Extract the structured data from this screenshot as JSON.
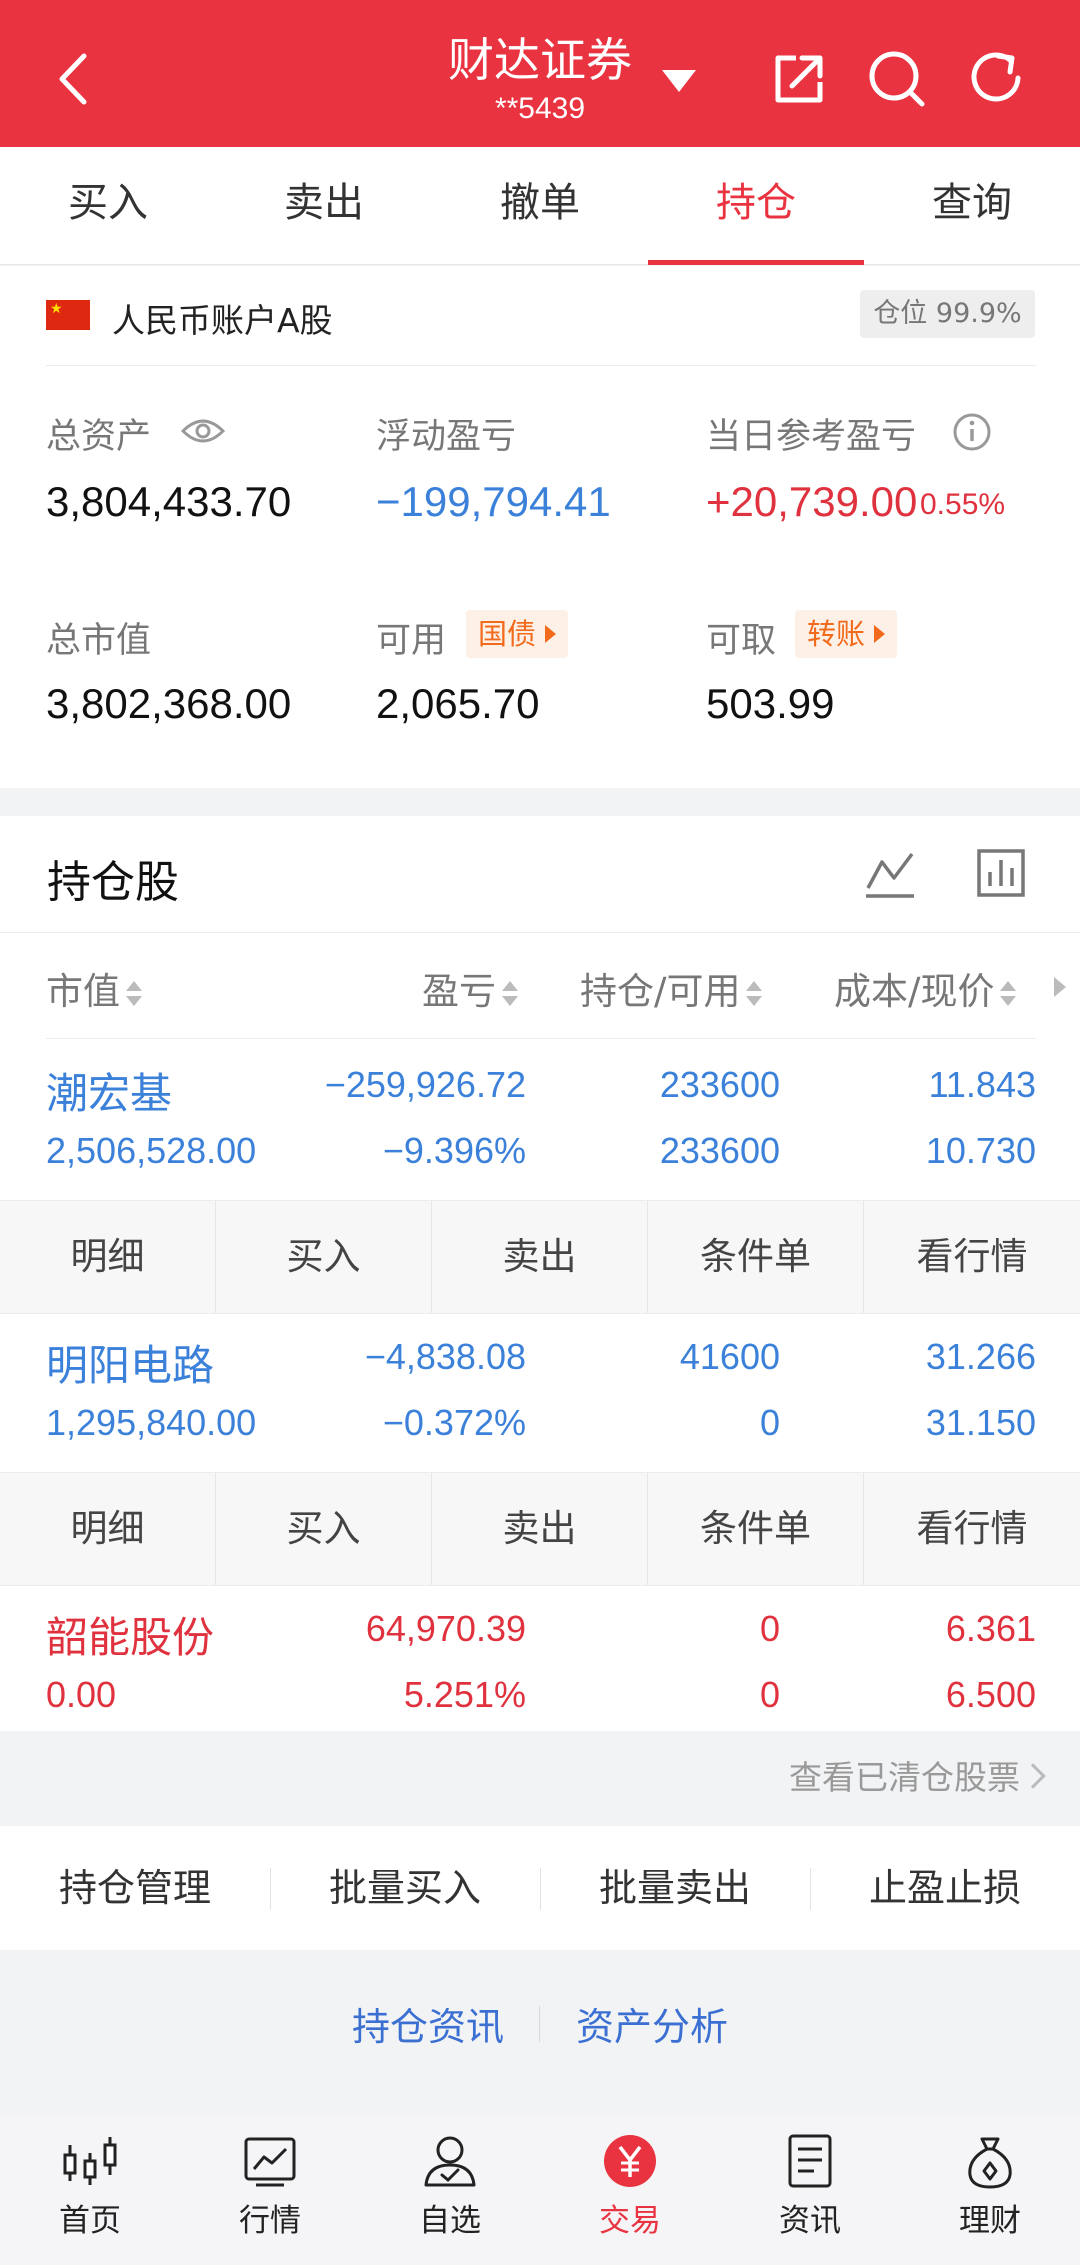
{
  "header": {
    "title": "财达证券",
    "account_masked": "**5439"
  },
  "tabs": [
    {
      "label": "买入"
    },
    {
      "label": "卖出"
    },
    {
      "label": "撤单"
    },
    {
      "label": "持仓",
      "active": true
    },
    {
      "label": "查询"
    }
  ],
  "account": {
    "name": "人民币账户A股",
    "position_ratio": "仓位 99.9%",
    "total_assets_label": "总资产",
    "total_assets": "3,804,433.70",
    "floating_pl_label": "浮动盈亏",
    "floating_pl": "−199,794.41",
    "daily_pl_label": "当日参考盈亏",
    "daily_pl": "+20,739.00",
    "daily_pl_pct": "0.55%",
    "market_value_label": "总市值",
    "market_value": "3,802,368.00",
    "available_label": "可用",
    "available_chip": "国债",
    "available": "2,065.70",
    "withdrawable_label": "可取",
    "withdrawable_chip": "转账",
    "withdrawable": "503.99"
  },
  "holdings": {
    "title": "持仓股",
    "columns": [
      "市值",
      "盈亏",
      "持仓/可用",
      "成本/现价"
    ],
    "stocks": [
      {
        "name": "潮宏基",
        "market_value": "2,506,528.00",
        "pl": "−259,926.72",
        "pl_pct": "−9.396%",
        "position": "233600",
        "available": "233600",
        "cost": "11.843",
        "price": "10.730",
        "tone": "blue"
      },
      {
        "name": "明阳电路",
        "market_value": "1,295,840.00",
        "pl": "−4,838.08",
        "pl_pct": "−0.372%",
        "position": "41600",
        "available": "0",
        "cost": "31.266",
        "price": "31.150",
        "tone": "blue"
      },
      {
        "name": "韶能股份",
        "market_value": "0.00",
        "pl": "64,970.39",
        "pl_pct": "5.251%",
        "position": "0",
        "available": "0",
        "cost": "6.361",
        "price": "6.500",
        "tone": "red"
      }
    ],
    "actions": [
      "明细",
      "买入",
      "卖出",
      "条件单",
      "看行情"
    ],
    "view_cleared": "查看已清仓股票"
  },
  "tools": [
    "持仓管理",
    "批量买入",
    "批量卖出",
    "止盈止损"
  ],
  "links": [
    "持仓资讯",
    "资产分析"
  ],
  "nav": [
    {
      "label": "首页",
      "icon": "candlestick-icon"
    },
    {
      "label": "行情",
      "icon": "chart-icon"
    },
    {
      "label": "自选",
      "icon": "user-icon"
    },
    {
      "label": "交易",
      "icon": "yuan-icon",
      "active": true
    },
    {
      "label": "资讯",
      "icon": "news-icon"
    },
    {
      "label": "理财",
      "icon": "money-bag-icon"
    }
  ],
  "colors": {
    "brand_red": "#ea3340",
    "loss_blue": "#3b80d9",
    "gain_red": "#e0323e",
    "chip_orange": "#f26a1b"
  }
}
